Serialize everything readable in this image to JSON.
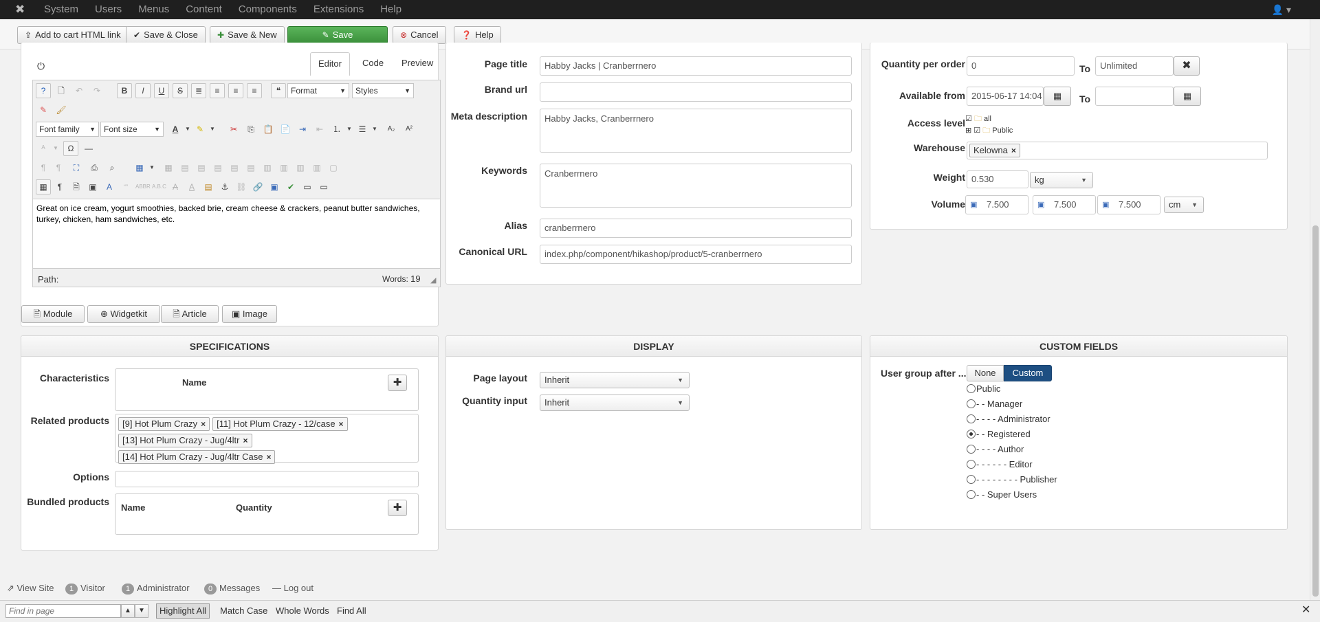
{
  "topnav": {
    "menu": [
      "System",
      "Users",
      "Menus",
      "Content",
      "Components",
      "Extensions",
      "Help"
    ]
  },
  "toolbar": {
    "add_cart_link": "Add to cart HTML link",
    "save_close": "Save & Close",
    "save_new": "Save & New",
    "save": "Save",
    "cancel": "Cancel",
    "help": "Help"
  },
  "editor": {
    "tabs": [
      "Editor",
      "Code",
      "Preview"
    ],
    "format_label": "Format",
    "styles_label": "Styles",
    "font_family_label": "Font family",
    "font_size_label": "Font size",
    "content": "Great on ice cream, yogurt smoothies, backed brie, cream cheese & crackers, peanut butter sandwiches, turkey, chicken, ham sandwiches, etc.",
    "path_label": "Path:",
    "words_label": "Words:",
    "words_count": "19",
    "buttons": [
      "Module",
      "Widgetkit",
      "Article",
      "Image"
    ]
  },
  "seo": {
    "page_title_label": "Page title",
    "page_title_value": "Habby Jacks | Cranberrnero",
    "brand_url_label": "Brand url",
    "brand_url_value": "",
    "meta_description_label": "Meta description",
    "meta_description_value": "Habby Jacks, Cranberrnero",
    "keywords_label": "Keywords",
    "keywords_value": "Cranberrnero",
    "alias_label": "Alias",
    "alias_value": "cranberrnero",
    "canonical_label": "Canonical URL",
    "canonical_value": "index.php/component/hikashop/product/5-cranberrnero"
  },
  "restrictions": {
    "qty_per_order_label": "Quantity per order",
    "qty_min": "0",
    "to_label": "To",
    "qty_max": "Unlimited",
    "available_from_label": "Available from",
    "available_from_value": "2015-06-17 14:04",
    "available_to_value": "",
    "access_level_label": "Access level",
    "access_tree": [
      "all",
      "Public"
    ],
    "warehouse_label": "Warehouse",
    "warehouse_tag": "Kelowna",
    "weight_label": "Weight",
    "weight_value": "0.530",
    "weight_unit": "kg",
    "volume_label": "Volume",
    "volume_values": [
      "7.500",
      "7.500",
      "7.500"
    ],
    "volume_unit": "cm"
  },
  "specifications": {
    "title": "SPECIFICATIONS",
    "characteristics_label": "Characteristics",
    "characteristics_col": "Name",
    "related_label": "Related products",
    "related_items": [
      "[9] Hot Plum Crazy",
      "[11] Hot Plum Crazy - 12/case",
      "[13] Hot Plum Crazy - Jug/4ltr",
      "[14] Hot Plum Crazy - Jug/4ltr Case"
    ],
    "options_label": "Options",
    "bundled_label": "Bundled products",
    "bundled_cols": [
      "Name",
      "Quantity"
    ]
  },
  "display": {
    "title": "DISPLAY",
    "page_layout_label": "Page layout",
    "page_layout_value": "Inherit",
    "qty_input_label": "Quantity input",
    "qty_input_value": "Inherit"
  },
  "custom_fields": {
    "title": "CUSTOM FIELDS",
    "user_group_label": "User group after ...",
    "toggle": [
      "None",
      "Custom"
    ],
    "groups": [
      "Public",
      "- - Manager",
      "- - - - Administrator",
      "- - Registered",
      "- - - - Author",
      "- - - - - - Editor",
      "- - - - - - - - Publisher",
      "- - Super Users"
    ],
    "selected_group": "- - Registered"
  },
  "statusbar": {
    "view_site": "View Site",
    "visitor_count": "1",
    "visitor_label": "Visitor",
    "admin_count": "1",
    "admin_label": "Administrator",
    "messages_count": "0",
    "messages_label": "Messages",
    "logout": "Log out"
  },
  "findbar": {
    "placeholder": "Find in page",
    "highlight_all": "Highlight All",
    "match_case": "Match Case",
    "whole_words": "Whole Words",
    "find_all": "Find All"
  },
  "colors": {
    "topnav_bg": "#1f1f1f",
    "save_green": "#46a046",
    "custom_blue": "#1e4f82",
    "cancel_red": "#c52827"
  }
}
